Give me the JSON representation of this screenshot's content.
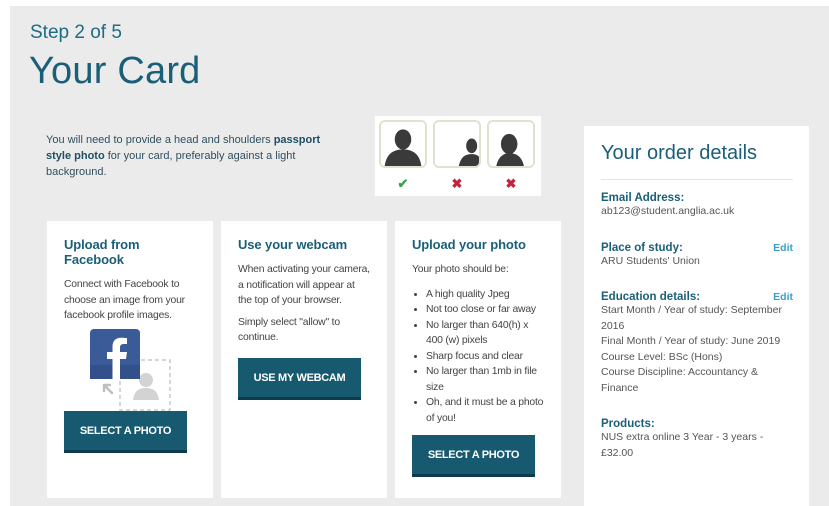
{
  "header": {
    "step": "Step 2 of 5",
    "title": "Your Card"
  },
  "intro": {
    "text_before": "You will need to provide a head and shoulders ",
    "bold": "passport style photo",
    "text_after": " for your card, preferably against a light background."
  },
  "samples": {
    "marks": [
      "✔",
      "✖",
      "✖"
    ],
    "colors": {
      "ok": "#3aa346",
      "no": "#c0253b"
    }
  },
  "cards": {
    "facebook": {
      "title": "Upload from Facebook",
      "text": "Connect with Facebook to choose an image from your facebook profile images.",
      "button": "SELECT A PHOTO",
      "icon": "facebook-icon"
    },
    "webcam": {
      "title": "Use your webcam",
      "text1": "When activating your camera, a notification will appear at the top of your browser.",
      "text2": "Simply select \"allow\" to continue.",
      "button": "USE MY WEBCAM"
    },
    "upload": {
      "title": "Upload your photo",
      "text": "Your photo should be:",
      "items": [
        "A high quality Jpeg",
        "Not too close or far away",
        "No larger than 640(h) x 400 (w) pixels",
        "Sharp focus and clear",
        "No larger than 1mb in file size",
        "Oh, and it must be a photo of you!"
      ],
      "button": "SELECT A PHOTO"
    }
  },
  "order": {
    "title": "Your order details",
    "email_label": "Email Address:",
    "email": "ab123@student.anglia.ac.uk",
    "place_label": "Place of study:",
    "place": "ARU Students' Union",
    "edu_label": "Education details:",
    "edu_start": "Start Month / Year of study: September 2016",
    "edu_final": "Final Month / Year of study: June 2019",
    "edu_level": "Course Level: BSc (Hons)",
    "edu_discipline": "Course Discipline: Accountancy & Finance",
    "products_label": "Products:",
    "products": "NUS extra online 3 Year - 3 years - £32.00",
    "edit": "Edit"
  },
  "colors": {
    "brand": "#1a5f78",
    "button": "#17596e",
    "link": "#3b9ecb",
    "background": "#ebebeb"
  }
}
